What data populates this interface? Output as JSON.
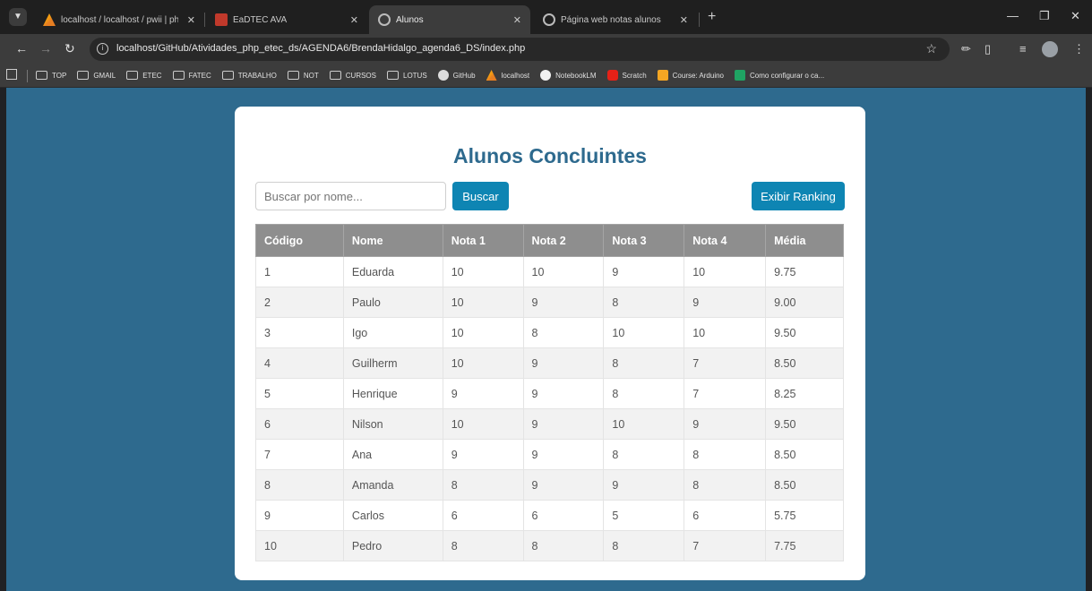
{
  "browser": {
    "tabs": [
      {
        "title": "localhost / localhost / pwii | phpM",
        "icon": "phpmyadmin-icon"
      },
      {
        "title": "EaDTEC AVA",
        "icon": "ava-icon"
      },
      {
        "title": "Alunos",
        "icon": "globe-icon",
        "active": true
      },
      {
        "title": "Página web notas alunos",
        "icon": "globe-icon"
      }
    ],
    "url": "localhost/GitHub/Atividades_php_etec_ds/AGENDA6/BrendaHidalgo_agenda6_DS/index.php",
    "bookmarks": [
      {
        "label": "TOP",
        "icon": "folder-icon"
      },
      {
        "label": "GMAIL",
        "icon": "folder-icon"
      },
      {
        "label": "ETEC",
        "icon": "folder-icon"
      },
      {
        "label": "FATEC",
        "icon": "folder-icon"
      },
      {
        "label": "TRABALHO",
        "icon": "folder-icon"
      },
      {
        "label": "NOT",
        "icon": "folder-icon"
      },
      {
        "label": "CURSOS",
        "icon": "folder-icon"
      },
      {
        "label": "LOTUS",
        "icon": "folder-icon"
      },
      {
        "label": "GitHub",
        "icon": "github-icon"
      },
      {
        "label": "localhost",
        "icon": "phpmyadmin-icon"
      },
      {
        "label": "NotebookLM",
        "icon": "notebooklm-icon"
      },
      {
        "label": "Scratch",
        "icon": "youtube-icon"
      },
      {
        "label": "Course: Arduino",
        "icon": "arduino-icon"
      },
      {
        "label": "Como configurar o ca...",
        "icon": "drive-icon"
      }
    ]
  },
  "page": {
    "title": "Alunos Concluintes",
    "search": {
      "placeholder": "Buscar por nome...",
      "value": ""
    },
    "search_button": "Buscar",
    "ranking_button": "Exibir Ranking",
    "table": {
      "headers": [
        "Código",
        "Nome",
        "Nota 1",
        "Nota 2",
        "Nota 3",
        "Nota 4",
        "Média"
      ],
      "rows": [
        [
          "1",
          "Eduarda",
          "10",
          "10",
          "9",
          "10",
          "9.75"
        ],
        [
          "2",
          "Paulo",
          "10",
          "9",
          "8",
          "9",
          "9.00"
        ],
        [
          "3",
          "Igo",
          "10",
          "8",
          "10",
          "10",
          "9.50"
        ],
        [
          "4",
          "Guilherm",
          "10",
          "9",
          "8",
          "7",
          "8.50"
        ],
        [
          "5",
          "Henrique",
          "9",
          "9",
          "8",
          "7",
          "8.25"
        ],
        [
          "6",
          "Nilson",
          "10",
          "9",
          "10",
          "9",
          "9.50"
        ],
        [
          "7",
          "Ana",
          "9",
          "9",
          "8",
          "8",
          "8.50"
        ],
        [
          "8",
          "Amanda",
          "8",
          "9",
          "9",
          "8",
          "8.50"
        ],
        [
          "9",
          "Carlos",
          "6",
          "6",
          "5",
          "6",
          "5.75"
        ],
        [
          "10",
          "Pedro",
          "8",
          "8",
          "8",
          "7",
          "7.75"
        ]
      ]
    }
  },
  "colors": {
    "page_background": "#2e6a8e",
    "title": "#2e6a8e",
    "button": "#0e85b3",
    "table_header": "#8e8e8e"
  }
}
